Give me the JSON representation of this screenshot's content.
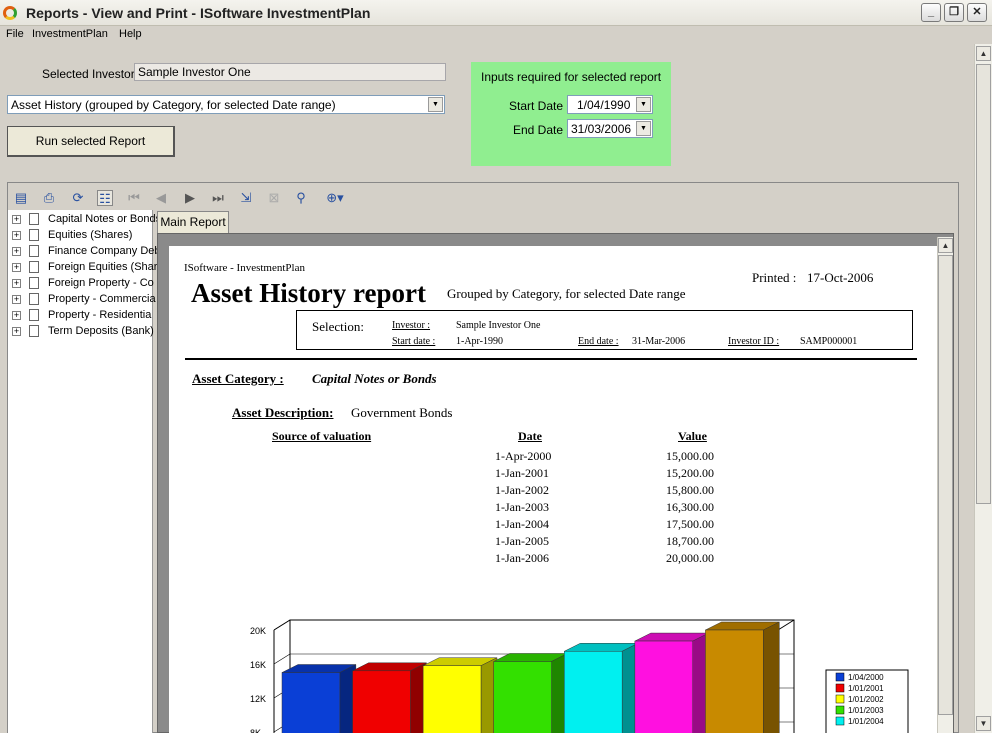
{
  "window": {
    "title": "Reports - View and Print - ISoftware InvestmentPlan",
    "minimize_label": "_",
    "restore_label": "❐",
    "close_label": "✕"
  },
  "menu": [
    "File",
    "InvestmentPlan",
    "Help"
  ],
  "selected_investor": {
    "label": "Selected Investor",
    "value": "Sample Investor One"
  },
  "report_select": {
    "value": "Asset History  (grouped by Category,  for selected Date range)"
  },
  "run_button": "Run selected Report",
  "inputs_panel": {
    "title": "Inputs required for selected report",
    "start_date_label": "Start Date",
    "start_date_value": "1/04/1990",
    "end_date_label": "End Date",
    "end_date_value": "31/03/2006"
  },
  "toolbar_icons": [
    "export-icon",
    "print-icon",
    "refresh-icon",
    "group-tree-icon",
    "first-page-icon",
    "prev-page-icon",
    "next-page-icon",
    "last-page-icon",
    "goto-page-icon",
    "stop-icon",
    "search-icon",
    "zoom-icon"
  ],
  "tree_items": [
    "Capital Notes or Bonds",
    "Equities (Shares)",
    "Finance Company Deb",
    "Foreign Equities (Shar",
    "Foreign Property - Co",
    "Property - Commercia",
    "Property - Residentia",
    "Term Deposits (Bank)"
  ],
  "tab_label": "Main Report",
  "report": {
    "company": "ISoftware - InvestmentPlan",
    "title": "Asset History report",
    "subtitle": "Grouped by Category, for selected Date range",
    "printed_label": "Printed :",
    "printed_value": "17-Oct-2006",
    "selection_label": "Selection:",
    "investor_label": "Investor :",
    "investor_value": "Sample Investor One",
    "start_date_label": "Start date :",
    "start_date_value": "1-Apr-1990",
    "end_date_label": "End date :",
    "end_date_value": "31-Mar-2006",
    "investor_id_label": "Investor ID :",
    "investor_id_value": "SAMP000001",
    "category_label": "Asset Category :",
    "category_value": "Capital Notes or Bonds",
    "description_label": "Asset Description:",
    "description_value": "Government Bonds",
    "col_source": "Source of valuation",
    "col_date": "Date",
    "col_value": "Value",
    "rows": [
      {
        "date": "1-Apr-2000",
        "value": "15,000.00"
      },
      {
        "date": "1-Jan-2001",
        "value": "15,200.00"
      },
      {
        "date": "1-Jan-2002",
        "value": "15,800.00"
      },
      {
        "date": "1-Jan-2003",
        "value": "16,300.00"
      },
      {
        "date": "1-Jan-2004",
        "value": "17,500.00"
      },
      {
        "date": "1-Jan-2005",
        "value": "18,700.00"
      },
      {
        "date": "1-Jan-2006",
        "value": "20,000.00"
      }
    ]
  },
  "chart_data": {
    "type": "bar",
    "categories": [
      "1/04/2000",
      "1/01/2001",
      "1/01/2002",
      "1/01/2003",
      "1/01/2004",
      "1/01/2005",
      "1/01/2006"
    ],
    "values": [
      15000,
      15200,
      15800,
      16300,
      17500,
      18700,
      20000
    ],
    "colors": [
      "#0a3fd6",
      "#f00000",
      "#ffff00",
      "#33e000",
      "#00f0f0",
      "#ff10e0",
      "#c88a00"
    ],
    "yticks": [
      "20K",
      "16K",
      "12K",
      "8K"
    ],
    "ytick_values": [
      20000,
      16000,
      12000,
      8000
    ],
    "legend_visible": [
      "1/04/2000",
      "1/01/2001",
      "1/01/2002",
      "1/01/2003",
      "1/01/2004"
    ],
    "legend_position": "right"
  }
}
